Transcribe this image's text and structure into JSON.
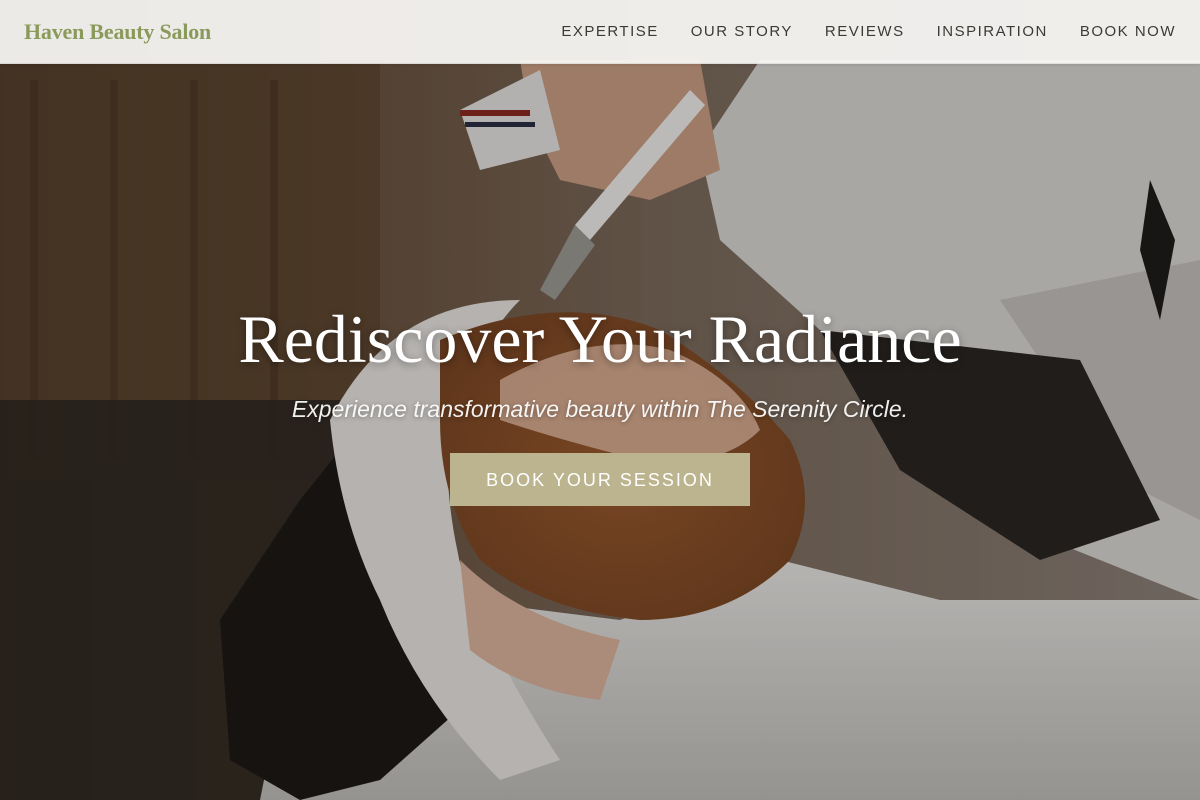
{
  "brand": {
    "name": "Haven Beauty Salon",
    "color": "#8a9a5b"
  },
  "nav": {
    "links": [
      {
        "label": "EXPERTISE"
      },
      {
        "label": "OUR STORY"
      },
      {
        "label": "REVIEWS"
      },
      {
        "label": "INSPIRATION"
      },
      {
        "label": "BOOK NOW"
      }
    ]
  },
  "hero": {
    "title": "Rediscover Your Radiance",
    "subtitle": "Experience transformative beauty within The Serenity Circle.",
    "cta_label": "BOOK YOUR SESSION",
    "cta_color": "#bcb48e"
  }
}
